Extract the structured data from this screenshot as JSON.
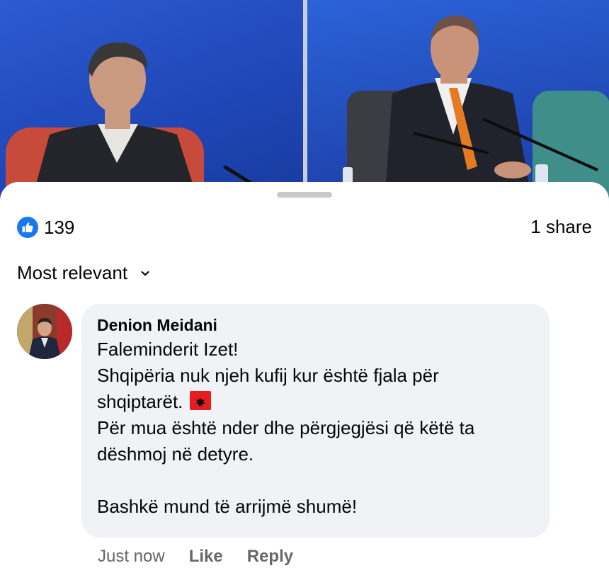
{
  "post": {
    "reaction_count": "139",
    "reaction_icon": "like-icon",
    "share_text": "1 share"
  },
  "comments_sort": {
    "label": "Most relevant",
    "icon": "chevron-down-icon"
  },
  "comment": {
    "author": "Denion Meidani",
    "lines": [
      "Faleminderit Izet!",
      "Shqipëria nuk njeh kufij kur është fjala për",
      "shqiptarët.",
      "Për mua është nder dhe përgjegjësi që këtë ta",
      "dëshmoj në detyre.",
      "",
      "Bashkë mund të arrijmë shumë!"
    ],
    "emoji": "albania-flag",
    "time": "Just now",
    "like_label": "Like",
    "reply_label": "Reply"
  },
  "colors": {
    "like_blue": "#1877f2",
    "bubble_bg": "#f0f2f5",
    "meta_gray": "#65676b",
    "flag_red": "#e41e20"
  }
}
